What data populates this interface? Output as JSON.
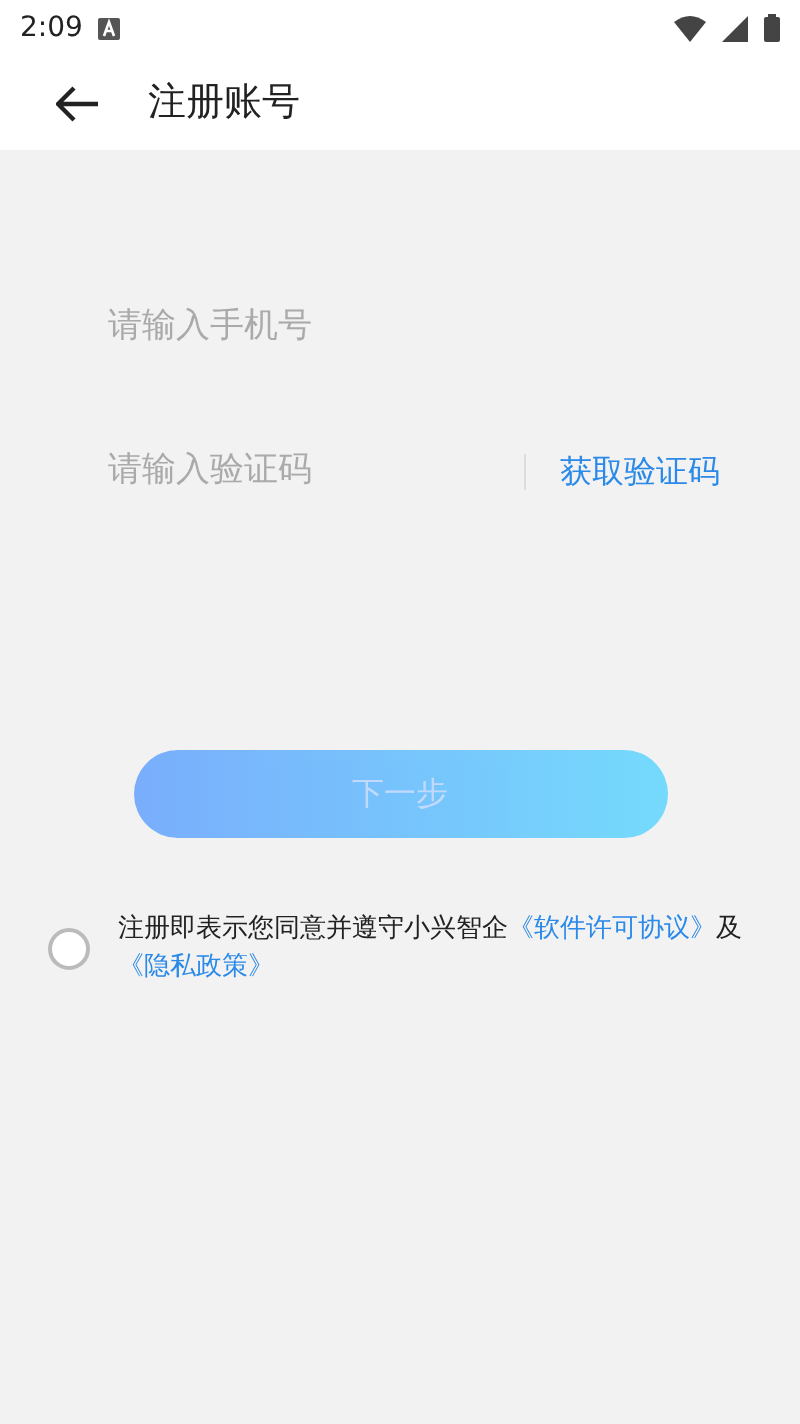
{
  "status_bar": {
    "time": "2:09"
  },
  "header": {
    "title": "注册账号"
  },
  "form": {
    "phone": {
      "placeholder": "请输入手机号"
    },
    "code": {
      "placeholder": "请输入验证码"
    },
    "get_code": "获取验证码"
  },
  "next_button": {
    "label": "下一步",
    "disabled": true
  },
  "agreement": {
    "checked": false,
    "text": "注册即表示您同意并遵守小兴智企",
    "link_1": "《软件许可协议》",
    "joiner": "及",
    "link_2": "《隐私政策》"
  }
}
